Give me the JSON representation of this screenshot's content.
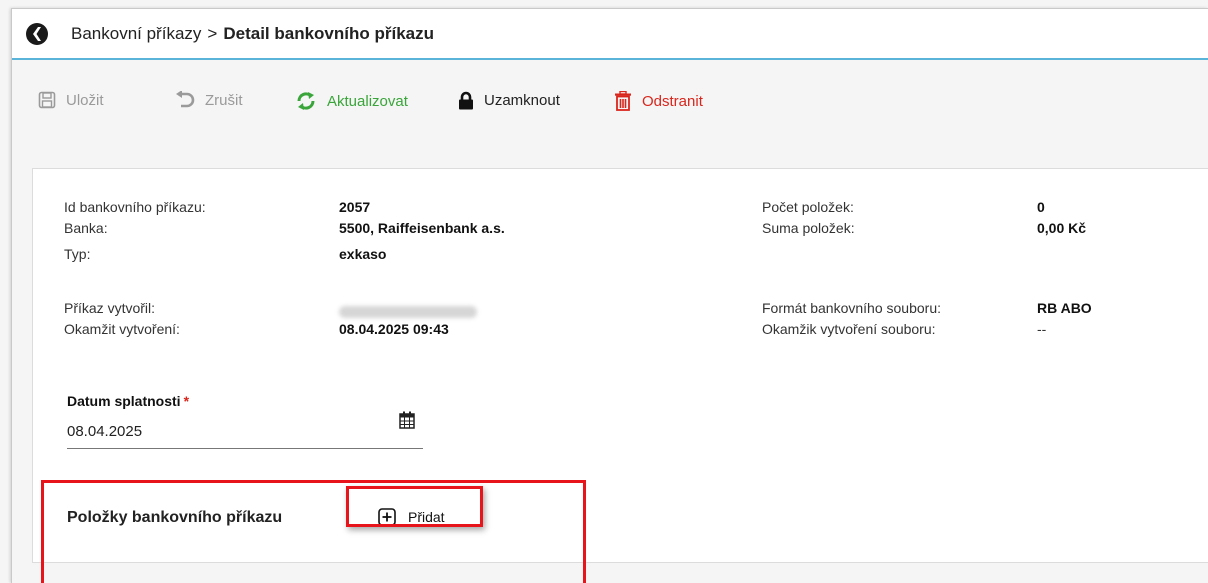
{
  "breadcrumb": {
    "parent": "Bankovní příkazy",
    "separator": ">",
    "current": "Detail bankovního příkazu"
  },
  "toolbar": {
    "save_label": "Uložit",
    "cancel_label": "Zrušit",
    "refresh_label": "Aktualizovat",
    "lock_label": "Uzamknout",
    "delete_label": "Odstranit"
  },
  "details": {
    "id_label": "Id bankovního příkazu:",
    "id_value": "2057",
    "bank_label": "Banka:",
    "bank_value": "5500, Raiffeisenbank a.s.",
    "type_label": "Typ:",
    "type_value": "exkaso",
    "created_by_label": "Příkaz vytvořil:",
    "created_at_label": "Okamžit vytvoření:",
    "created_at_value": "08.04.2025 09:43",
    "item_count_label": "Počet položek:",
    "item_count_value": "0",
    "item_sum_label": "Suma položek:",
    "item_sum_value": "0,00 Kč",
    "file_format_label": "Formát bankovního souboru:",
    "file_format_value": "RB ABO",
    "file_created_label": "Okamžik vytvoření souboru:",
    "file_created_value": "--"
  },
  "due_date": {
    "label": "Datum splatnosti",
    "required_mark": "*",
    "value": "08.04.2025"
  },
  "items_section": {
    "title": "Položky bankovního příkazu",
    "add_label": "Přidat"
  },
  "colors": {
    "accent_line": "#5ab4d9",
    "refresh_green": "#3aa53a",
    "delete_red": "#d9261c",
    "highlight_red": "#e8141b"
  },
  "icons": {
    "save": "save-icon",
    "cancel": "undo-icon",
    "refresh": "refresh-icon",
    "lock": "lock-icon",
    "delete": "trash-icon",
    "calendar": "calendar-icon",
    "add": "plus-square-icon"
  }
}
